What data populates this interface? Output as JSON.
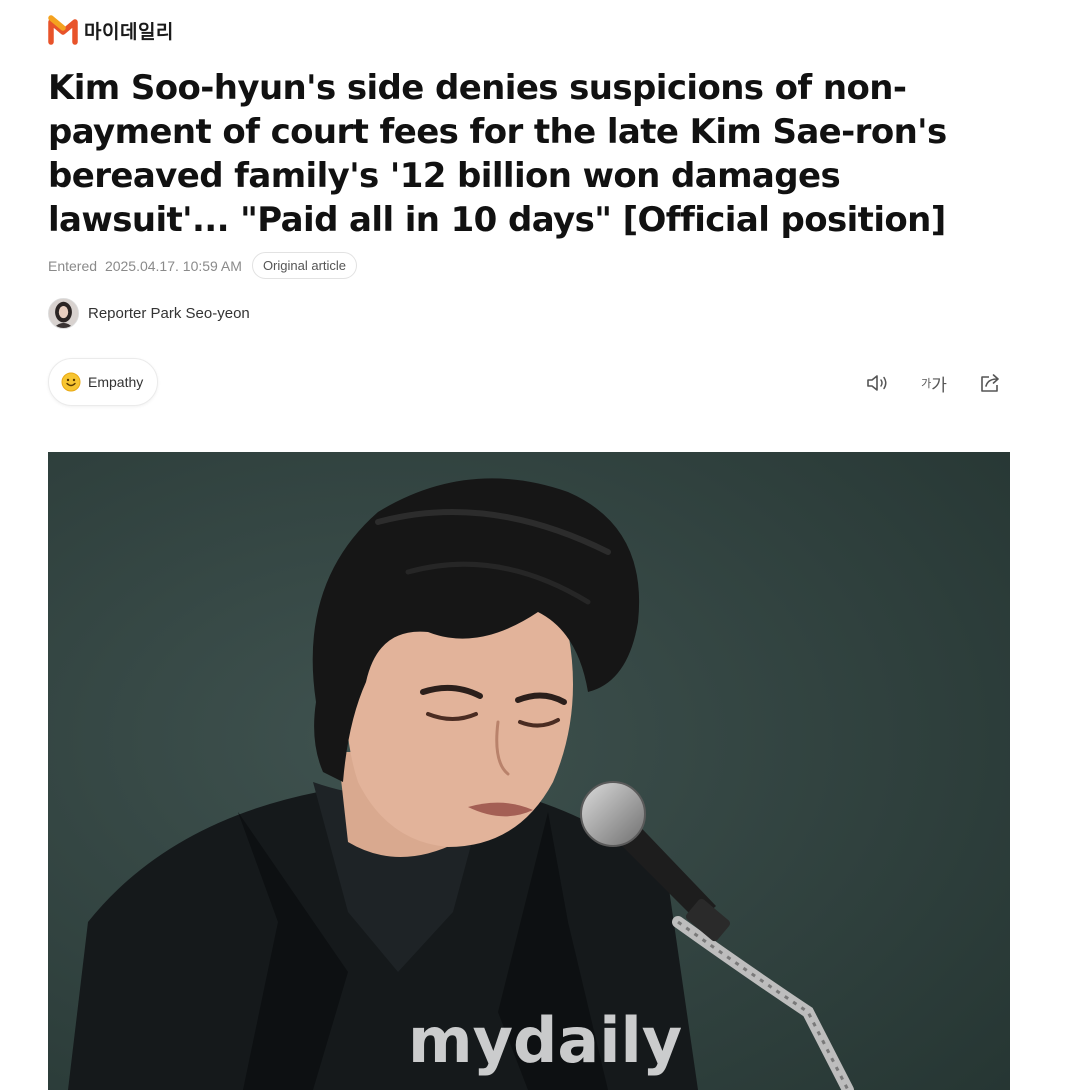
{
  "publisher": {
    "name": "마이데일리",
    "logo_icon": "mydaily-m-logo-icon",
    "brand_color": "#e8532a"
  },
  "article": {
    "headline": "Kim Soo-hyun's side denies suspicions of non-payment of court fees for the late Kim Sae-ron's bereaved family's '12 billion won damages lawsuit'... \"Paid all in 10 days\" [Official position]",
    "entered_label": "Entered",
    "entered_datetime": "2025.04.17. 10:59 AM",
    "original_article_label": "Original article",
    "reporter": "Reporter Park Seo-yeon"
  },
  "actions": {
    "empathy_label": "Empathy",
    "empathy_icon": "smiley-icon",
    "tts_icon": "speaker-icon",
    "font_size_small": "가",
    "font_size_large": "가",
    "font_size_icon": "font-size-icon",
    "share_icon": "share-icon"
  },
  "photo": {
    "watermark": "mydaily",
    "subject": "man in black suit speaking at a microphone, crying",
    "background_color": "#2d3f3c"
  }
}
